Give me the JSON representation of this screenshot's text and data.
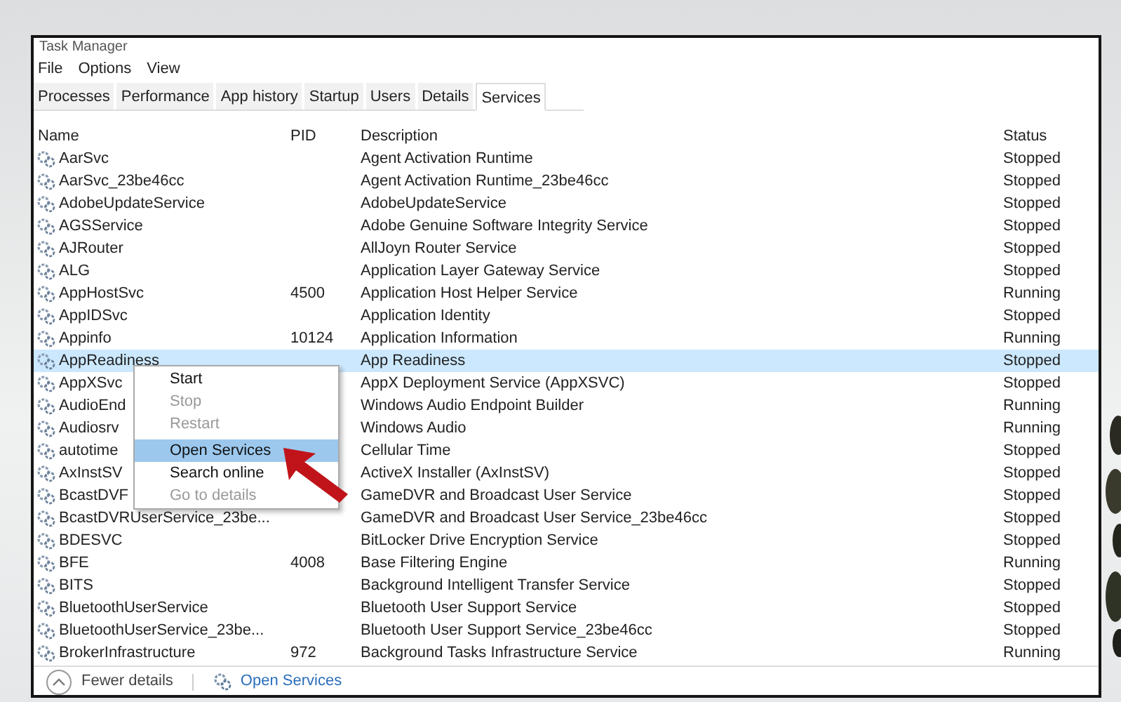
{
  "window": {
    "title": "Task Manager"
  },
  "menu": [
    "File",
    "Options",
    "View"
  ],
  "tabs": [
    {
      "label": "Processes",
      "selected": false
    },
    {
      "label": "Performance",
      "selected": false
    },
    {
      "label": "App history",
      "selected": false
    },
    {
      "label": "Startup",
      "selected": false
    },
    {
      "label": "Users",
      "selected": false
    },
    {
      "label": "Details",
      "selected": false
    },
    {
      "label": "Services",
      "selected": true
    }
  ],
  "columns": [
    "Name",
    "PID",
    "Description",
    "Status"
  ],
  "rows": [
    {
      "name": "AarSvc",
      "pid": "",
      "description": "Agent Activation Runtime",
      "status": "Stopped",
      "selected": false
    },
    {
      "name": "AarSvc_23be46cc",
      "pid": "",
      "description": "Agent Activation Runtime_23be46cc",
      "status": "Stopped",
      "selected": false
    },
    {
      "name": "AdobeUpdateService",
      "pid": "",
      "description": "AdobeUpdateService",
      "status": "Stopped",
      "selected": false
    },
    {
      "name": "AGSService",
      "pid": "",
      "description": "Adobe Genuine Software Integrity Service",
      "status": "Stopped",
      "selected": false
    },
    {
      "name": "AJRouter",
      "pid": "",
      "description": "AllJoyn Router Service",
      "status": "Stopped",
      "selected": false
    },
    {
      "name": "ALG",
      "pid": "",
      "description": "Application Layer Gateway Service",
      "status": "Stopped",
      "selected": false
    },
    {
      "name": "AppHostSvc",
      "pid": "4500",
      "description": "Application Host Helper Service",
      "status": "Running",
      "selected": false
    },
    {
      "name": "AppIDSvc",
      "pid": "",
      "description": "Application Identity",
      "status": "Stopped",
      "selected": false
    },
    {
      "name": "Appinfo",
      "pid": "10124",
      "description": "Application Information",
      "status": "Running",
      "selected": false
    },
    {
      "name": "AppReadiness",
      "pid": "",
      "description": "App Readiness",
      "status": "Stopped",
      "selected": true
    },
    {
      "name": "AppXSvc",
      "pid": "",
      "description": "AppX Deployment Service (AppXSVC)",
      "status": "Stopped",
      "selected": false
    },
    {
      "name": "AudioEnd",
      "pid": "",
      "description": "Windows Audio Endpoint Builder",
      "status": "Running",
      "selected": false
    },
    {
      "name": "Audiosrv",
      "pid": "",
      "description": "Windows Audio",
      "status": "Running",
      "selected": false
    },
    {
      "name": "autotime",
      "pid": "",
      "description": "Cellular Time",
      "status": "Stopped",
      "selected": false
    },
    {
      "name": "AxInstSV",
      "pid": "",
      "description": "ActiveX Installer (AxInstSV)",
      "status": "Stopped",
      "selected": false
    },
    {
      "name": "BcastDVF",
      "pid": "",
      "description": "GameDVR and Broadcast User Service",
      "status": "Stopped",
      "selected": false
    },
    {
      "name": "BcastDVRUserService_23be...",
      "pid": "",
      "description": "GameDVR and Broadcast User Service_23be46cc",
      "status": "Stopped",
      "selected": false
    },
    {
      "name": "BDESVC",
      "pid": "",
      "description": "BitLocker Drive Encryption Service",
      "status": "Stopped",
      "selected": false
    },
    {
      "name": "BFE",
      "pid": "4008",
      "description": "Base Filtering Engine",
      "status": "Running",
      "selected": false
    },
    {
      "name": "BITS",
      "pid": "",
      "description": "Background Intelligent Transfer Service",
      "status": "Stopped",
      "selected": false
    },
    {
      "name": "BluetoothUserService",
      "pid": "",
      "description": "Bluetooth User Support Service",
      "status": "Stopped",
      "selected": false
    },
    {
      "name": "BluetoothUserService_23be...",
      "pid": "",
      "description": "Bluetooth User Support Service_23be46cc",
      "status": "Stopped",
      "selected": false
    },
    {
      "name": "BrokerInfrastructure",
      "pid": "972",
      "description": "Background Tasks Infrastructure Service",
      "status": "Running",
      "selected": false
    }
  ],
  "context_menu": [
    {
      "label": "Start",
      "disabled": false,
      "selected": false
    },
    {
      "label": "Stop",
      "disabled": true,
      "selected": false
    },
    {
      "label": "Restart",
      "disabled": true,
      "selected": false,
      "separator_after": true
    },
    {
      "label": "Open Services",
      "disabled": false,
      "selected": true
    },
    {
      "label": "Search online",
      "disabled": false,
      "selected": false
    },
    {
      "label": "Go to details",
      "disabled": true,
      "selected": false
    }
  ],
  "footer": {
    "fewer_details": "Fewer details",
    "open_services": "Open Services"
  }
}
